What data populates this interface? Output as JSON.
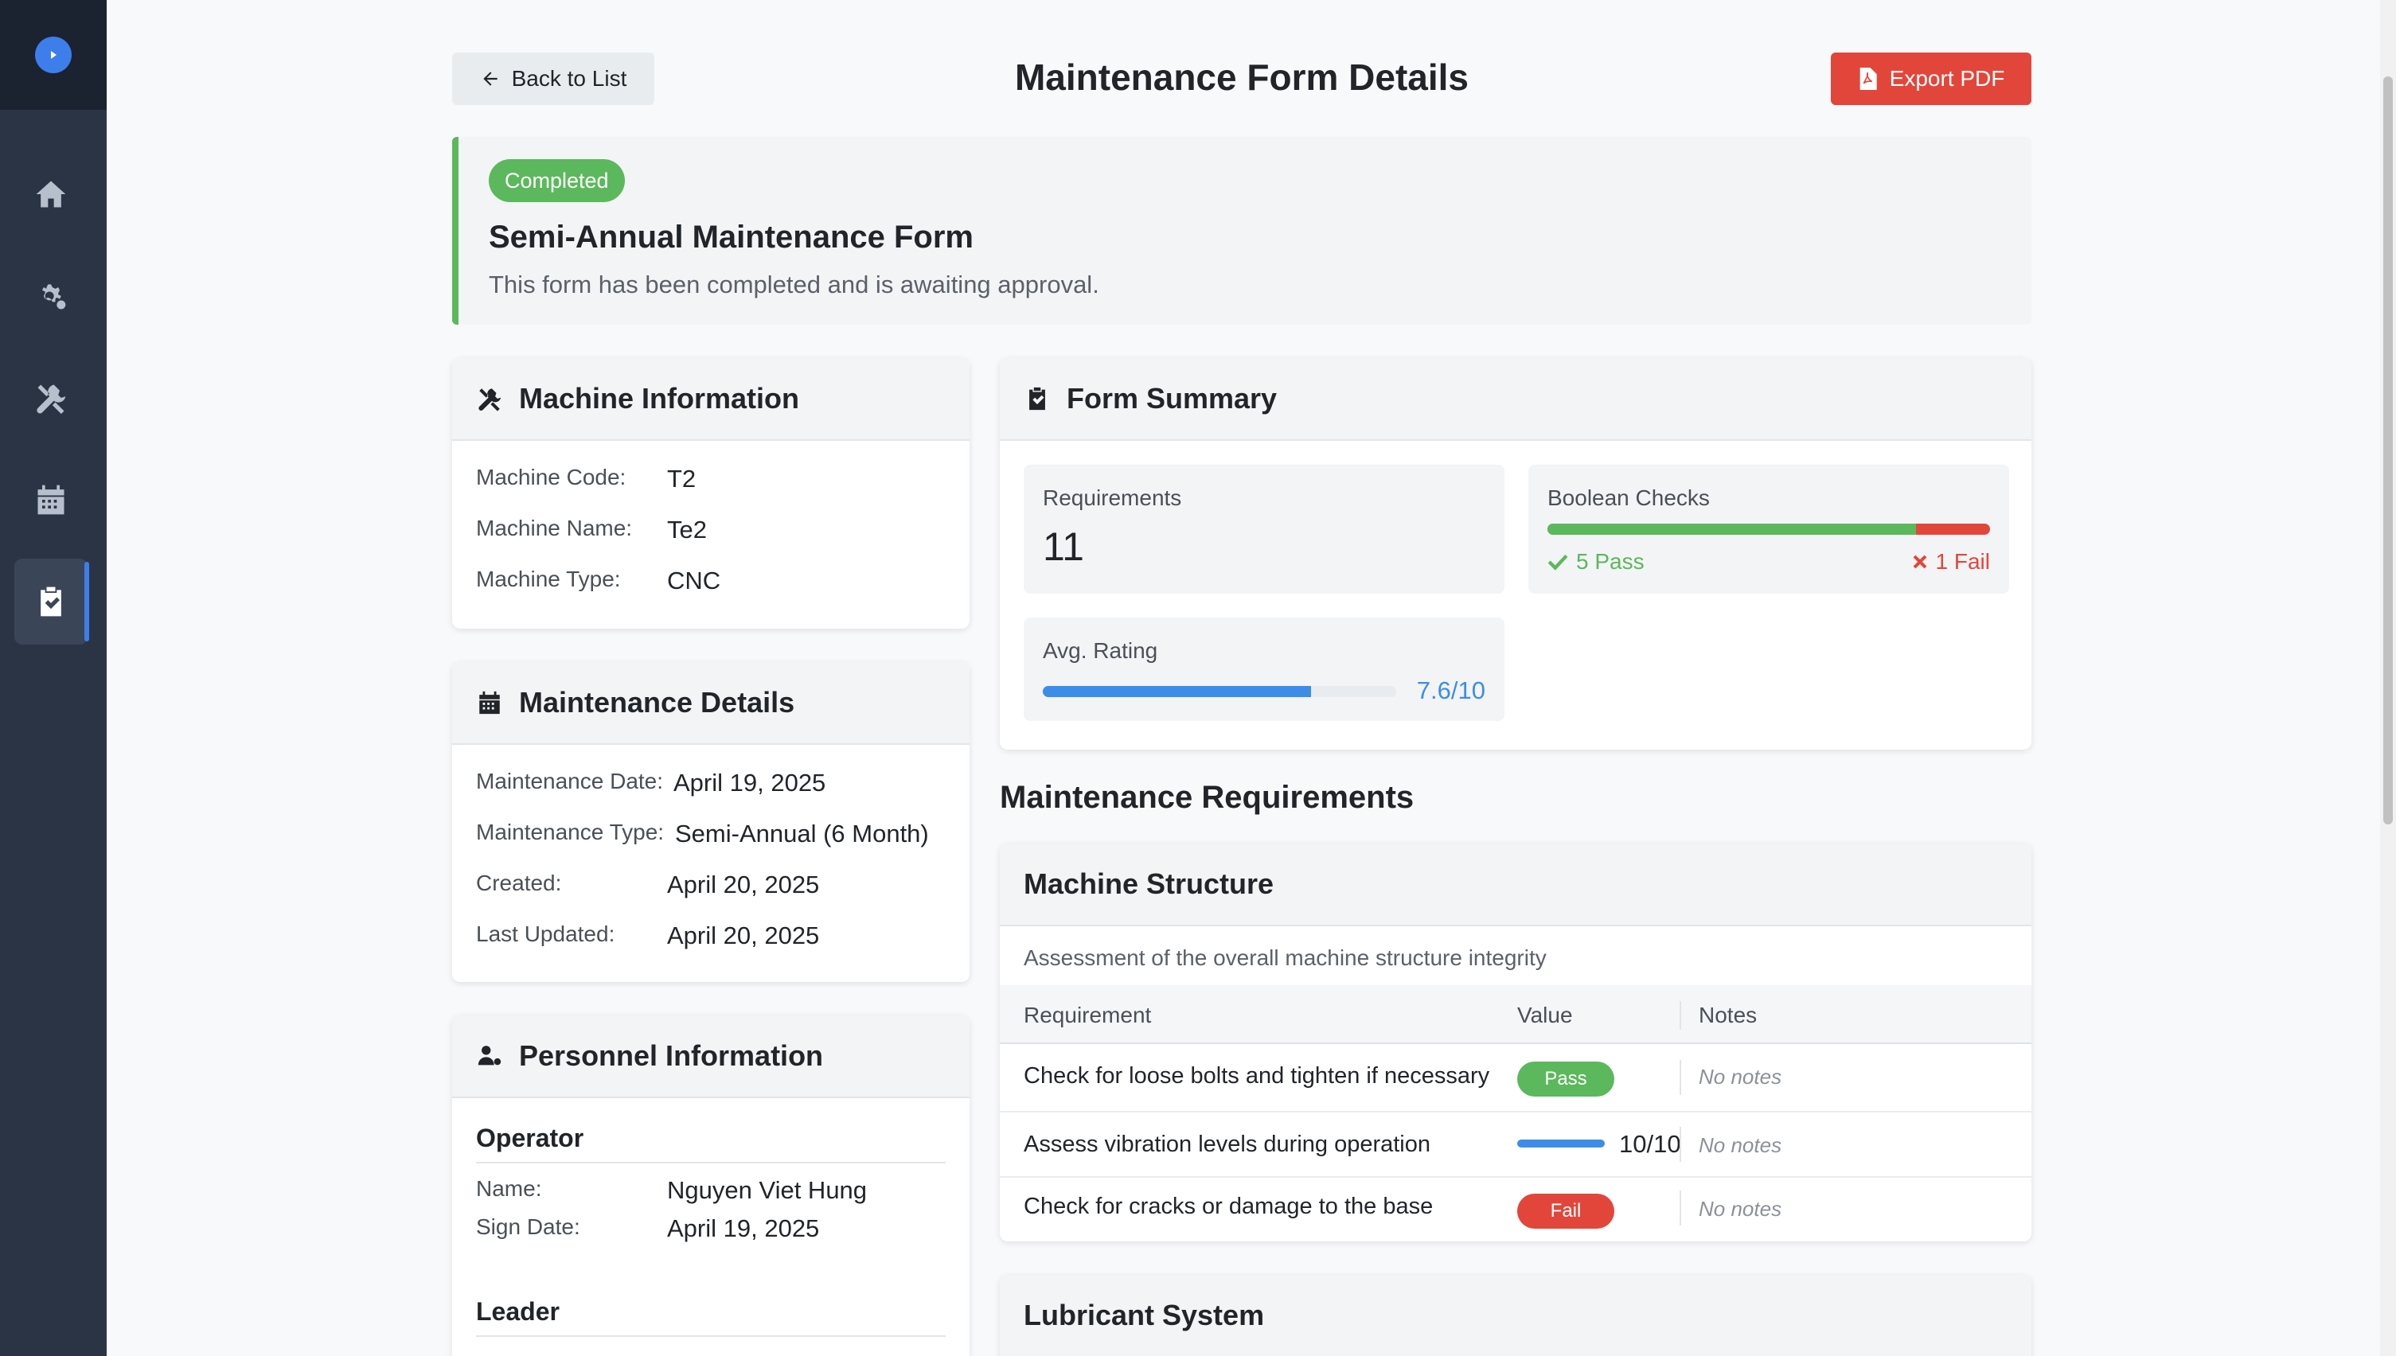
{
  "header": {
    "back_label": "Back to List",
    "title": "Maintenance Form Details",
    "export_label": "Export PDF"
  },
  "banner": {
    "status": "Completed",
    "form_title": "Semi-Annual Maintenance Form",
    "description": "This form has been completed and is awaiting approval.",
    "accent_color": "#5cb85c"
  },
  "sidebar": {
    "items": [
      {
        "icon": "home-icon"
      },
      {
        "icon": "gears-icon"
      },
      {
        "icon": "tools-icon"
      },
      {
        "icon": "calendar-icon"
      },
      {
        "icon": "clipboard-check-icon",
        "active": true
      }
    ]
  },
  "machine": {
    "title": "Machine Information",
    "code_label": "Machine Code:",
    "code": "T2",
    "name_label": "Machine Name:",
    "name": "Te2",
    "type_label": "Machine Type:",
    "type": "CNC"
  },
  "maintenance": {
    "title": "Maintenance Details",
    "date_label": "Maintenance Date:",
    "date": "April 19, 2025",
    "type_label": "Maintenance Type:",
    "type": "Semi-Annual (6 Month)",
    "created_label": "Created:",
    "created": "April 20, 2025",
    "updated_label": "Last Updated:",
    "updated": "April 20, 2025"
  },
  "personnel": {
    "title": "Personnel Information",
    "operator_heading": "Operator",
    "name_label": "Name:",
    "operator_name": "Nguyen Viet Hung",
    "sign_label": "Sign Date:",
    "operator_sign": "April 19, 2025",
    "leader_heading": "Leader"
  },
  "summary": {
    "title": "Form Summary",
    "requirements_label": "Requirements",
    "requirements_count": "11",
    "boolean_label": "Boolean Checks",
    "pass_text": "5 Pass",
    "fail_text": "1 Fail",
    "pass_fraction": 0.833,
    "rating_label": "Avg. Rating",
    "rating_text": "7.6/10",
    "rating_fraction": 0.76,
    "colors": {
      "pass": "#5cb85c",
      "fail": "#e2463b",
      "rating": "#3d8de8"
    }
  },
  "requirements": {
    "section_title": "Maintenance Requirements",
    "groups": [
      {
        "title": "Machine Structure",
        "description": "Assessment of the overall machine structure integrity",
        "columns": [
          "Requirement",
          "Value",
          "Notes"
        ],
        "rows": [
          {
            "requirement": "Check for loose bolts and tighten if necessary",
            "value": "Pass",
            "notes": "No notes"
          },
          {
            "requirement": "Assess vibration levels during operation",
            "value": "10/10",
            "rating_fraction": 1.0,
            "notes": "No notes"
          },
          {
            "requirement": "Check for cracks or damage to the base",
            "value": "Fail",
            "notes": "No notes"
          }
        ]
      },
      {
        "title": "Lubricant System"
      }
    ]
  }
}
